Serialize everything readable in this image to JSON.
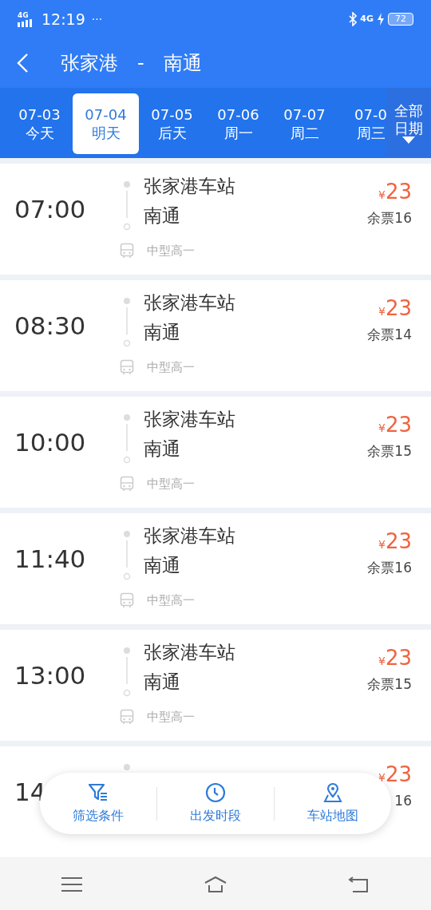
{
  "status_bar": {
    "network": "4G",
    "time": "12:19",
    "more": "···",
    "network_right": "4G",
    "battery": "72"
  },
  "header": {
    "from": "张家港",
    "separator": "-",
    "to": "南通"
  },
  "date_tabs": [
    {
      "date": "07-03",
      "day": "今天",
      "selected": false
    },
    {
      "date": "07-04",
      "day": "明天",
      "selected": true
    },
    {
      "date": "07-05",
      "day": "后天",
      "selected": false
    },
    {
      "date": "07-06",
      "day": "周一",
      "selected": false
    },
    {
      "date": "07-07",
      "day": "周二",
      "selected": false
    },
    {
      "date": "07-0",
      "day": "周三",
      "selected": false
    }
  ],
  "all_dates": {
    "line1": "全部",
    "line2": "日期"
  },
  "trips": [
    {
      "time": "07:00",
      "from": "张家港车站",
      "to": "南通",
      "bus_type": "中型高一",
      "currency": "¥",
      "price": "23",
      "seats": "余票16"
    },
    {
      "time": "08:30",
      "from": "张家港车站",
      "to": "南通",
      "bus_type": "中型高一",
      "currency": "¥",
      "price": "23",
      "seats": "余票14"
    },
    {
      "time": "10:00",
      "from": "张家港车站",
      "to": "南通",
      "bus_type": "中型高一",
      "currency": "¥",
      "price": "23",
      "seats": "余票15"
    },
    {
      "time": "11:40",
      "from": "张家港车站",
      "to": "南通",
      "bus_type": "中型高一",
      "currency": "¥",
      "price": "23",
      "seats": "余票16"
    },
    {
      "time": "13:00",
      "from": "张家港车站",
      "to": "南通",
      "bus_type": "中型高一",
      "currency": "¥",
      "price": "23",
      "seats": "余票15"
    },
    {
      "time": "14",
      "currency": "¥",
      "price": "23",
      "seats": "16"
    }
  ],
  "action_bar": [
    {
      "kind": "filter",
      "label": "筛选条件"
    },
    {
      "kind": "clock",
      "label": "出发时段"
    },
    {
      "kind": "map",
      "label": "车站地图"
    }
  ]
}
